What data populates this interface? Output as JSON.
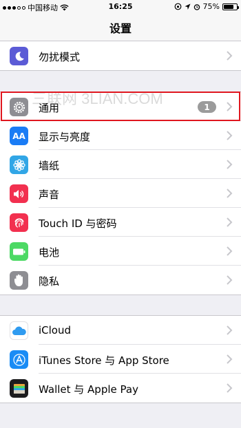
{
  "status_bar": {
    "carrier": "中国移动",
    "time": "16:25",
    "battery_percent": "75%",
    "battery_level": 0.75,
    "signal_dots_on": 3,
    "signal_dots_total": 5
  },
  "nav": {
    "title": "设置"
  },
  "watermark": "三联网 3LIAN.COM",
  "groups": [
    {
      "items": [
        {
          "label": "勿扰模式",
          "icon": "moon-icon",
          "color": "#5b5bd6"
        }
      ]
    },
    {
      "items": [
        {
          "label": "通用",
          "icon": "gear-icon",
          "color": "#8e8e93",
          "badge": "1"
        },
        {
          "label": "显示与亮度",
          "icon": "text-size-icon",
          "color": "#1a7cf5",
          "glyph": "AA"
        },
        {
          "label": "墙纸",
          "icon": "flower-icon",
          "color": "#31a6e6"
        },
        {
          "label": "声音",
          "icon": "speaker-icon",
          "color": "#f2304f"
        },
        {
          "label": "Touch ID 与密码",
          "icon": "fingerprint-icon",
          "color": "#f2304f"
        },
        {
          "label": "电池",
          "icon": "battery-icon",
          "color": "#4cd964"
        },
        {
          "label": "隐私",
          "icon": "hand-icon",
          "color": "#8e8e93"
        }
      ]
    },
    {
      "items": [
        {
          "label": "iCloud",
          "icon": "cloud-icon",
          "color": "#ffffff"
        },
        {
          "label": "iTunes Store 与 App Store",
          "icon": "app-store-icon",
          "color": "#1a8cf5"
        },
        {
          "label": "Wallet 与 Apple Pay",
          "icon": "wallet-icon",
          "color": "#1c1c1e"
        }
      ]
    }
  ]
}
